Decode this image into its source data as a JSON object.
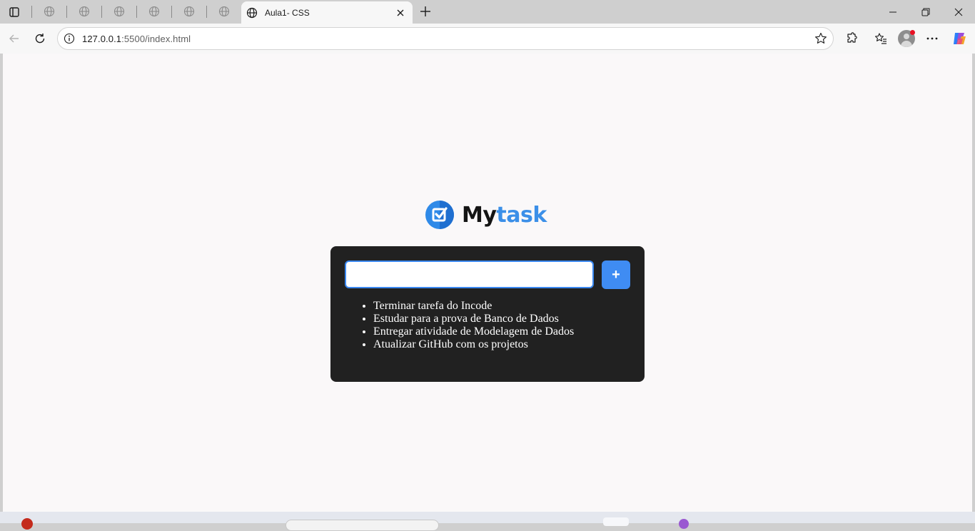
{
  "browser": {
    "active_tab": {
      "title": "Aula1- CSS",
      "icon": "globe-icon"
    },
    "pinned_tab_icons": [
      "globe-icon",
      "globe-icon",
      "globe-icon",
      "globe-icon",
      "globe-icon",
      "globe-icon"
    ],
    "address_bar": {
      "url_host": "127.0.0.1",
      "url_rest": ":5500/index.html"
    },
    "toolbar_icons": [
      "back-icon",
      "reload-icon",
      "site-info-icon",
      "favorite-star-icon",
      "extensions-icon",
      "favorites-icon",
      "profile-avatar",
      "more-menu-icon",
      "copilot-icon"
    ],
    "window_controls": [
      "minimize-icon",
      "restore-icon",
      "close-icon"
    ]
  },
  "app": {
    "logo": {
      "part1": "My",
      "part2": "task"
    },
    "input": {
      "value": "",
      "placeholder": ""
    },
    "add_button_label": "+",
    "tasks": [
      "Terminar tarefa do Incode",
      "Estudar para a prova de Banco de Dados",
      "Entregar atividade de Modelagem de Dados",
      "Atualizar GitHub com os projetos"
    ]
  },
  "colors": {
    "accent": "#3b8fe8",
    "card_bg": "#212121",
    "page_bg": "#faf8f9"
  }
}
